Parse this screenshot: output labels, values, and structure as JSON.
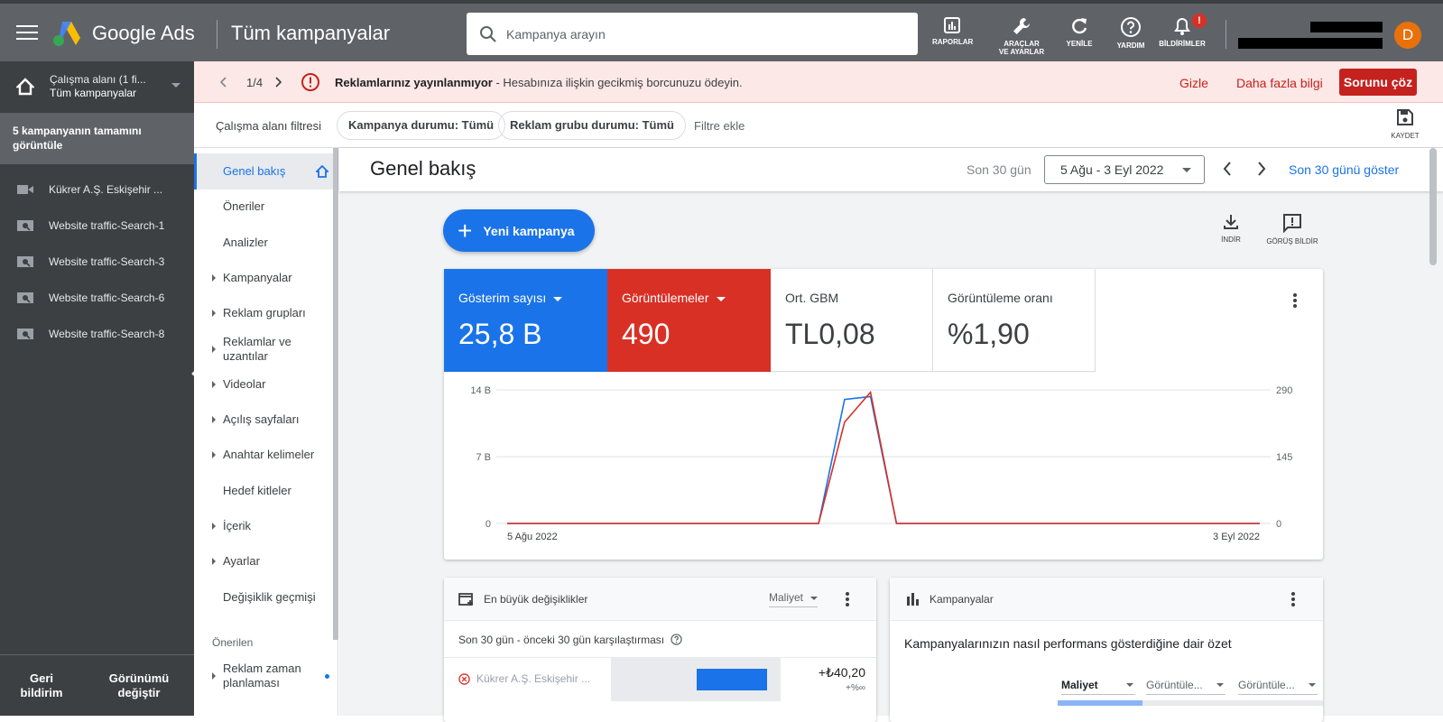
{
  "topbar": {
    "brand": "Google Ads",
    "page_title": "Tüm kampanyalar",
    "search_placeholder": "Kampanya arayın",
    "buttons": {
      "reports": "RAPORLAR",
      "tools_line1": "ARAÇLAR",
      "tools_line2": "VE AYARLAR",
      "refresh": "YENİLE",
      "help": "YARDIM",
      "notifications": "BİLDİRİMLER"
    },
    "notification_badge": "!",
    "avatar_letter": "D",
    "avatar_color": "#e8710a"
  },
  "workspace": {
    "line1": "Çalışma alanı (1 fi...",
    "line2": "Tüm kampanyalar"
  },
  "left_sidebar": {
    "all_campaigns": "5 kampanyanın tamamını görüntüle",
    "campaigns": [
      {
        "name": "Kükrer A.Ş. Eskişehir ...",
        "icon": "video-campaign-icon"
      },
      {
        "name": "Website traffic-Search-1",
        "icon": "search-campaign-icon"
      },
      {
        "name": "Website traffic-Search-3",
        "icon": "search-campaign-icon"
      },
      {
        "name": "Website traffic-Search-6",
        "icon": "search-campaign-icon"
      },
      {
        "name": "Website traffic-Search-8",
        "icon": "search-campaign-icon"
      }
    ],
    "footer": {
      "feedback": "Geri bildirim",
      "switch_view": "Görünümü değiştir"
    }
  },
  "alert": {
    "pager": "1/4",
    "title": "Reklamlarınız yayınlanmıyor",
    "message": " - Hesabınıza ilişkin gecikmiş borcunuzu ödeyin.",
    "hide": "Gizle",
    "more_info": "Daha fazla bilgi",
    "fix": "Sorunu çöz",
    "color": "#c5221f"
  },
  "filter_bar": {
    "label": "Çalışma alanı filtresi",
    "chips": [
      "Kampanya durumu: Tümü",
      "Reklam grubu durumu: Tümü"
    ],
    "add_filter": "Filtre ekle",
    "save": "KAYDET"
  },
  "secondary_nav": {
    "items": [
      {
        "label": "Genel bakış",
        "active": true,
        "expandable": false
      },
      {
        "label": "Öneriler",
        "expandable": false
      },
      {
        "label": "Analizler",
        "expandable": false
      },
      {
        "label": "Kampanyalar",
        "expandable": true
      },
      {
        "label": "Reklam grupları",
        "expandable": true
      },
      {
        "label": "Reklamlar ve uzantılar",
        "expandable": true
      },
      {
        "label": "Videolar",
        "expandable": true
      },
      {
        "label": "Açılış sayfaları",
        "expandable": true
      },
      {
        "label": "Anahtar kelimeler",
        "expandable": true
      },
      {
        "label": "Hedef kitleler",
        "expandable": false
      },
      {
        "label": "İçerik",
        "expandable": true
      },
      {
        "label": "Ayarlar",
        "expandable": true
      },
      {
        "label": "Değişiklik geçmişi",
        "expandable": false
      }
    ],
    "section_recommended": "Önerilen",
    "recommended_item": "Reklam zaman planlaması"
  },
  "overview": {
    "title": "Genel bakış",
    "period_label": "Son 30 gün",
    "date_range": "5 Ağu - 3 Eyl 2022",
    "show_last_30": "Son 30 günü göster",
    "new_campaign": "Yeni kampanya",
    "download": "İNDİR",
    "feedback": "GÖRÜŞ BİLDİR"
  },
  "metrics": [
    {
      "label": "Gösterim sayısı",
      "value": "25,8 B",
      "color": "#1a73e8",
      "selected": true
    },
    {
      "label": "Görüntülemeler",
      "value": "490",
      "color": "#d93025",
      "selected": true
    },
    {
      "label": "Ort. GBM",
      "value": "TL0,08",
      "selected": false
    },
    {
      "label": "Görüntüleme oranı",
      "value": "%1,90",
      "selected": false
    }
  ],
  "chart_data": {
    "type": "line",
    "x_start_label": "5 Ağu 2022",
    "x_end_label": "3 Eyl 2022",
    "y_left_ticks": [
      "0",
      "7 B",
      "14 B"
    ],
    "y_right_ticks": [
      "0",
      "145",
      "290"
    ],
    "y_left_range": [
      0,
      14
    ],
    "y_right_range": [
      0,
      290
    ],
    "series": [
      {
        "name": "Gösterim sayısı",
        "axis": "left",
        "color": "#1a73e8",
        "values": [
          0,
          0,
          0,
          0,
          0,
          0,
          0,
          0,
          0,
          0,
          0,
          0,
          0,
          13.0,
          13.3,
          0,
          0,
          0,
          0,
          0,
          0,
          0,
          0,
          0,
          0,
          0,
          0,
          0,
          0,
          0
        ]
      },
      {
        "name": "Görüntülemeler",
        "axis": "right",
        "color": "#d93025",
        "values": [
          0,
          0,
          0,
          0,
          0,
          0,
          0,
          0,
          0,
          0,
          0,
          0,
          0,
          220,
          285,
          0,
          0,
          0,
          0,
          0,
          0,
          0,
          0,
          0,
          0,
          0,
          0,
          0,
          0,
          0
        ]
      }
    ],
    "grid": true
  },
  "biggest_changes": {
    "title": "En büyük değişiklikler",
    "metric_select": "Maliyet",
    "comparison": "Son 30 gün - önceki 30 gün karşılaştırması",
    "row": {
      "name": "Kükrer A.Ş. Eskişehir ...",
      "value": "+₺40,20",
      "percent": "+%∞"
    }
  },
  "campaigns_card": {
    "title": "Kampanyalar",
    "summary": "Kampanyalarınızın nasıl performans gösterdiğine dair özet",
    "selects": [
      "Maliyet",
      "Görüntüle...",
      "Görüntüle..."
    ]
  }
}
